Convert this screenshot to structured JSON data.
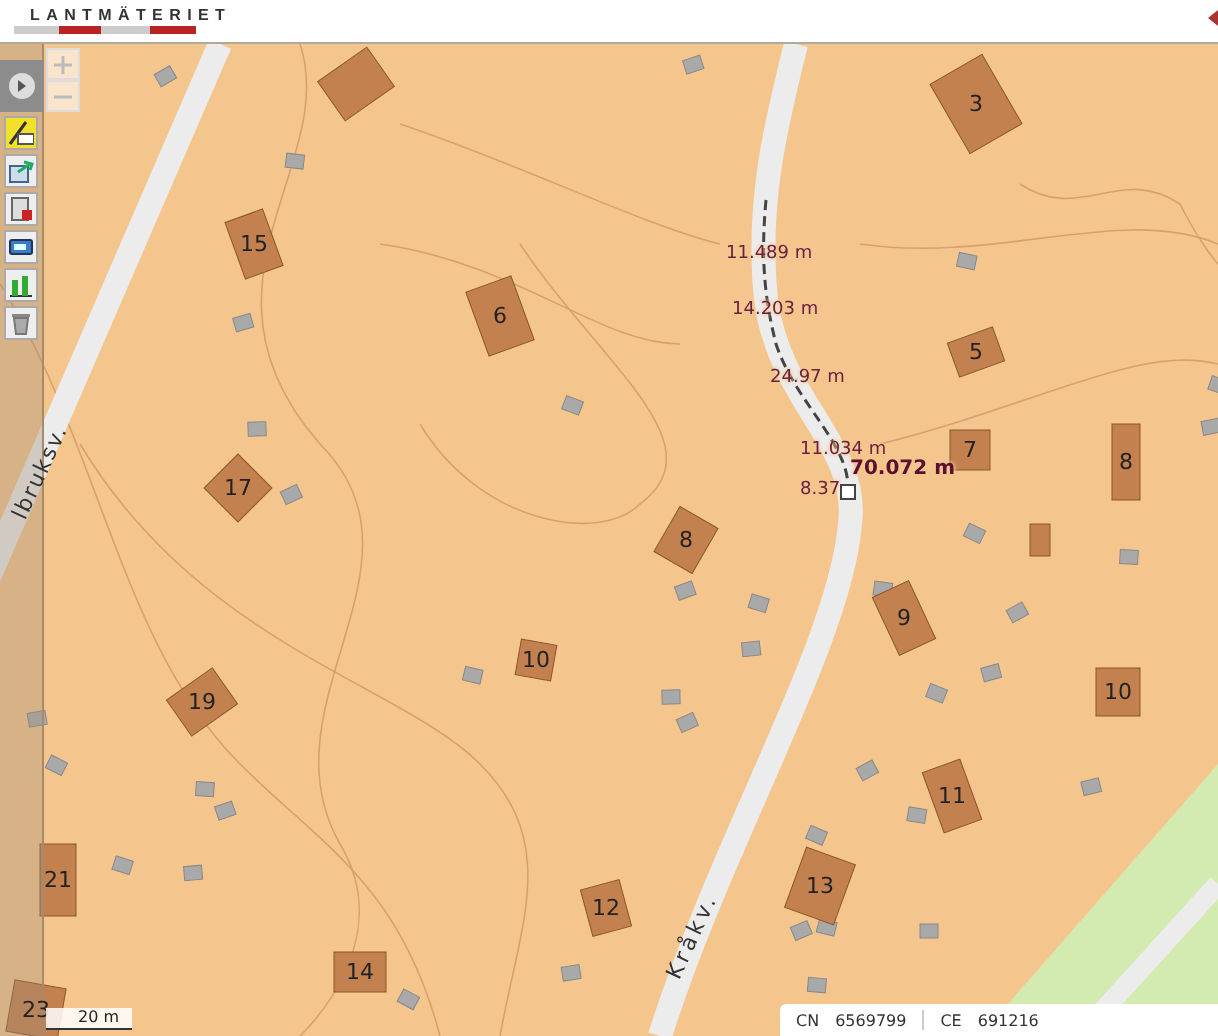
{
  "header": {
    "logo": "LANTMÄTERIET"
  },
  "tools": [
    {
      "kind": "measure",
      "selected": true
    },
    {
      "kind": "share",
      "selected": false
    },
    {
      "kind": "pdf",
      "selected": false
    },
    {
      "kind": "label",
      "selected": false
    },
    {
      "kind": "chart",
      "selected": false
    },
    {
      "kind": "delete",
      "selected": false
    }
  ],
  "map": {
    "buildings": [
      {
        "number": "3"
      },
      {
        "number": "15"
      },
      {
        "number": "6"
      },
      {
        "number": "5"
      },
      {
        "number": "7"
      },
      {
        "number": "8"
      },
      {
        "number": "17"
      },
      {
        "number": "8"
      },
      {
        "number": "9"
      },
      {
        "number": "10"
      },
      {
        "number": "19"
      },
      {
        "number": "10"
      },
      {
        "number": "11"
      },
      {
        "number": "21"
      },
      {
        "number": "13"
      },
      {
        "number": "12"
      },
      {
        "number": "14"
      },
      {
        "number": "23"
      }
    ],
    "streets": [
      {
        "name": "Kråkv."
      },
      {
        "name": "lbruksv."
      }
    ],
    "measurement": {
      "segments": [
        "11.489 m",
        "14.203 m",
        "24.97 m",
        "11.034 m",
        "8.37"
      ],
      "total": "70.072 m"
    },
    "scale": "20 m"
  },
  "coordinates": [
    {
      "axis": "CN",
      "value": "6569799"
    },
    {
      "axis": "CE",
      "value": "691216"
    }
  ]
}
